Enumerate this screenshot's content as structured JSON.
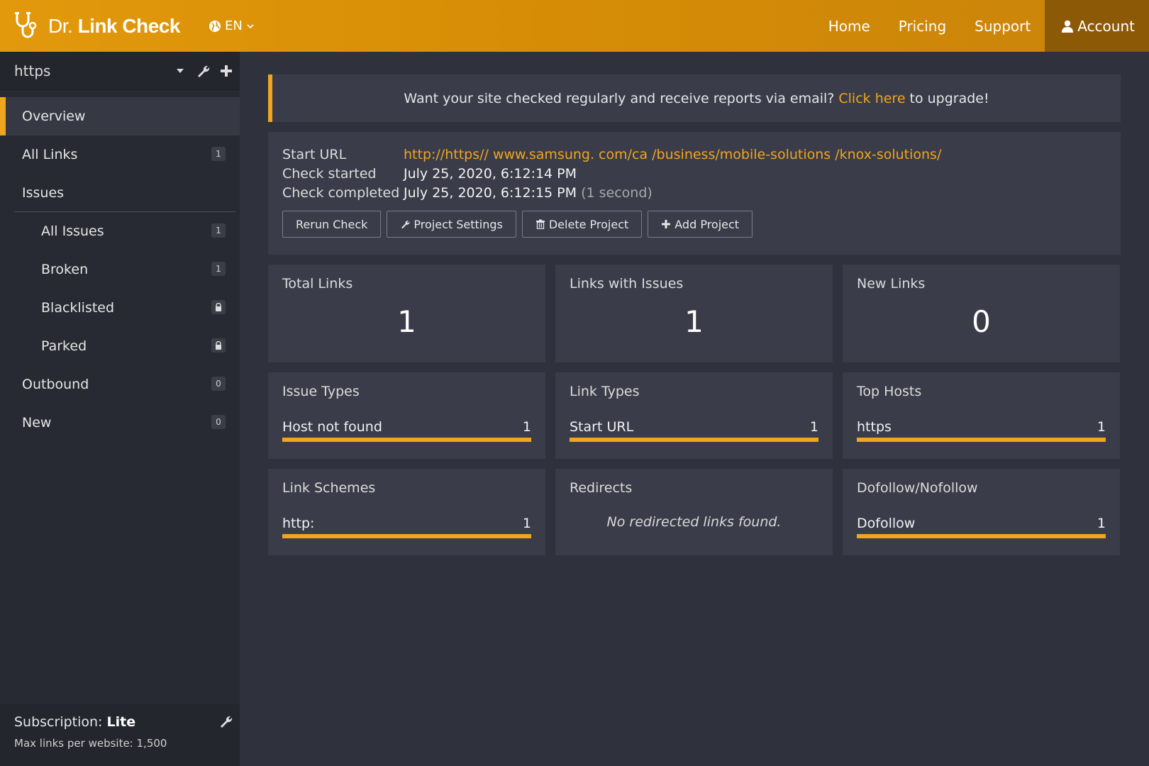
{
  "header": {
    "brand_prefix": "Dr.",
    "brand_main": "Link Check",
    "language": "EN",
    "nav": [
      "Home",
      "Pricing",
      "Support"
    ],
    "account": "Account",
    "accent": "#f0a51f"
  },
  "sidebar": {
    "project": "https",
    "items": [
      {
        "label": "Overview",
        "badge": ""
      },
      {
        "label": "All Links",
        "badge": "1"
      },
      {
        "label": "Issues",
        "badge": ""
      },
      {
        "label": "All Issues",
        "badge": "1"
      },
      {
        "label": "Broken",
        "badge": "1"
      },
      {
        "label": "Blacklisted",
        "badge": "lock-icon"
      },
      {
        "label": "Parked",
        "badge": "lock-icon"
      },
      {
        "label": "Outbound",
        "badge": "0"
      },
      {
        "label": "New",
        "badge": "0"
      }
    ],
    "subscription_label": "Subscription:",
    "subscription_plan": "Lite",
    "max_links": "Max links per website: 1,500"
  },
  "banner": {
    "before": "Want your site checked regularly and receive reports via email?",
    "link": "Click here",
    "after": "to upgrade!"
  },
  "info": {
    "start_url_label": "Start URL",
    "start_url": "http://https// www.samsung. com/ca /business/mobile-solutions /knox-solutions/",
    "check_started_label": "Check started",
    "check_started": "July 25, 2020, 6:12:14 PM",
    "check_completed_label": "Check completed",
    "check_completed": "July 25, 2020, 6:12:15 PM",
    "duration": "(1 second)",
    "buttons": [
      "Rerun Check",
      "Project Settings",
      "Delete Project",
      "Add Project"
    ]
  },
  "stats": {
    "total_links_label": "Total Links",
    "total_links": "1",
    "issues_label": "Links with Issues",
    "issues": "1",
    "new_links_label": "New Links",
    "new_links": "0"
  },
  "breakdowns": {
    "issue_types": {
      "title": "Issue Types",
      "label": "Host not found",
      "count": "1"
    },
    "link_types": {
      "title": "Link Types",
      "label": "Start URL",
      "count": "1"
    },
    "top_hosts": {
      "title": "Top Hosts",
      "label": "https",
      "count": "1"
    },
    "link_schemes": {
      "title": "Link Schemes",
      "label": "http:",
      "count": "1"
    },
    "redirects": {
      "title": "Redirects",
      "note": "No redirected links found."
    },
    "follow": {
      "title": "Dofollow/Nofollow",
      "label": "Dofollow",
      "count": "1"
    }
  }
}
